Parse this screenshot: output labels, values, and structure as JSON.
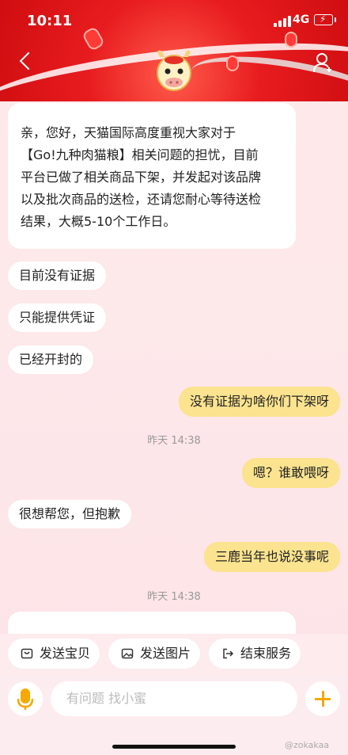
{
  "status_bar": {
    "time": "10:11",
    "network": "4G"
  },
  "messages": {
    "intro": "亲，您好，天猫国际高度重视大家对于\n【Go!九种肉猫粮】相关问题的担忧，目前\n平台已做了相关商品下架，并发起对该品牌\n以及批次商品的送检，还请您耐心等待送检\n结果，大概5-10个工作日。",
    "m1": "目前没有证据",
    "m2": "只能提供凭证",
    "m3": "已经开封的",
    "m4": "没有证据为啥你们下架呀",
    "ts1": "昨天 14:38",
    "m5": "嗯？谁敢喂呀",
    "m6": "很想帮您，但抱歉",
    "m7": "三鹿当年也说没事呢",
    "ts2": "昨天 14:38"
  },
  "quick_actions": {
    "send_item": "发送宝贝",
    "send_image": "发送图片",
    "end_service": "结束服务"
  },
  "input": {
    "placeholder": "有问题 找小蜜"
  },
  "watermark": "@zokakaa",
  "colors": {
    "header_red": "#e81c1f",
    "outgoing_bubble": "#fbe38f",
    "accent": "#f6a800"
  }
}
